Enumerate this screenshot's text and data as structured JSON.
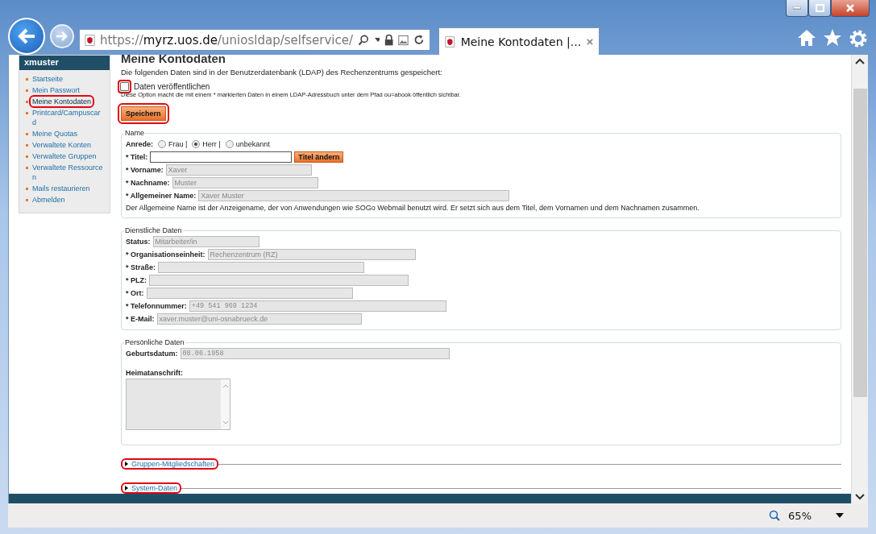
{
  "browser": {
    "url": "https://**myrz.uos.de**/uniosldap/selfservice/",
    "tab_title": "Meine Kontodaten |...",
    "zoom": "65%"
  },
  "sidebar": {
    "user": "xmuster",
    "items": [
      {
        "label": "Startseite",
        "selected": false,
        "highlighted": false
      },
      {
        "label": "Mein Passwort",
        "selected": false,
        "highlighted": false
      },
      {
        "label": "Meine Kontodaten",
        "selected": true,
        "highlighted": true
      },
      {
        "label": "Printcard/Campuscard",
        "selected": false,
        "highlighted": false
      },
      {
        "label": "Meine Quotas",
        "selected": false,
        "highlighted": false
      },
      {
        "label": "Verwaltete Konten",
        "selected": false,
        "highlighted": false
      },
      {
        "label": "Verwaltete Gruppen",
        "selected": false,
        "highlighted": false
      },
      {
        "label": "Verwaltete Ressourcen",
        "selected": false,
        "highlighted": false
      },
      {
        "label": "Mails restaurieren",
        "selected": false,
        "highlighted": false
      },
      {
        "label": "Abmelden",
        "selected": false,
        "highlighted": false
      }
    ]
  },
  "page": {
    "title": "Meine Kontodaten",
    "intro": "Die folgenden Daten sind in der Benutzerdatenbank (LDAP) des Rechenzentrums gespeichert:",
    "publish": {
      "label": "Daten veröffentlichen",
      "checked": false,
      "highlighted": true,
      "note": "Diese Option macht die mit einem * markierten Daten in einem LDAP-Adressbuch unter dem Pfad ou=abook öffentlich sichtbar."
    },
    "save_button": {
      "label": "Speichern",
      "highlighted": true
    },
    "sections": [
      {
        "legend": "Name",
        "fields": [
          {
            "kind": "radio",
            "label": "Anrede:",
            "options": [
              {
                "label": "Frau |",
                "selected": false
              },
              {
                "label": "Herr |",
                "selected": true
              },
              {
                "label": "unbekannt",
                "selected": false
              }
            ]
          },
          {
            "kind": "input",
            "label": "* Titel:",
            "button": "Titel ändern"
          },
          {
            "kind": "readonly",
            "label": "* Vorname:",
            "value": "Xaver"
          },
          {
            "kind": "readonly",
            "label": "* Nachname:",
            "value": "Muster"
          },
          {
            "kind": "readonly",
            "label": "* Allgemeiner Name:",
            "value": "Xaver Muster"
          },
          {
            "kind": "note",
            "text": "Der Allgemeine Name ist der Anzeigename, der von Anwendungen wie SOGo Webmail benutzt wird. Er setzt sich aus dem Titel, dem Vornamen und dem Nachnamen zusammen."
          }
        ]
      },
      {
        "legend": "Dienstliche Daten",
        "fields": [
          {
            "kind": "readonly",
            "label": "Status:",
            "value": "Mitarbeiter/in"
          },
          {
            "kind": "readonly",
            "label": "* Organisationseinheit:",
            "value": "Rechenzentrum (RZ)"
          },
          {
            "kind": "readonly",
            "label": "* Straße:"
          },
          {
            "kind": "readonly",
            "label": "* PLZ:"
          },
          {
            "kind": "readonly",
            "label": "* Ort:"
          },
          {
            "kind": "readonly",
            "label": "* Telefonnummer:",
            "value": "+49 541 969 1234",
            "mono": true
          },
          {
            "kind": "readonly",
            "label": "* E-Mail:",
            "value": "xaver.muster@uni-osnabrueck.de"
          }
        ]
      },
      {
        "legend": "Persönliche Daten",
        "fields": [
          {
            "kind": "readonly",
            "label": "Geburtsdatum:",
            "value": "08.06.1958",
            "mono": true
          },
          {
            "kind": "textarea",
            "label": "Heimatanschrift:"
          }
        ]
      }
    ],
    "collapsibles": [
      {
        "label": "Gruppen-Mitgliedschaften",
        "expanded": false,
        "highlighted": true
      },
      {
        "label": "System-Daten",
        "expanded": false,
        "highlighted": true
      }
    ]
  }
}
